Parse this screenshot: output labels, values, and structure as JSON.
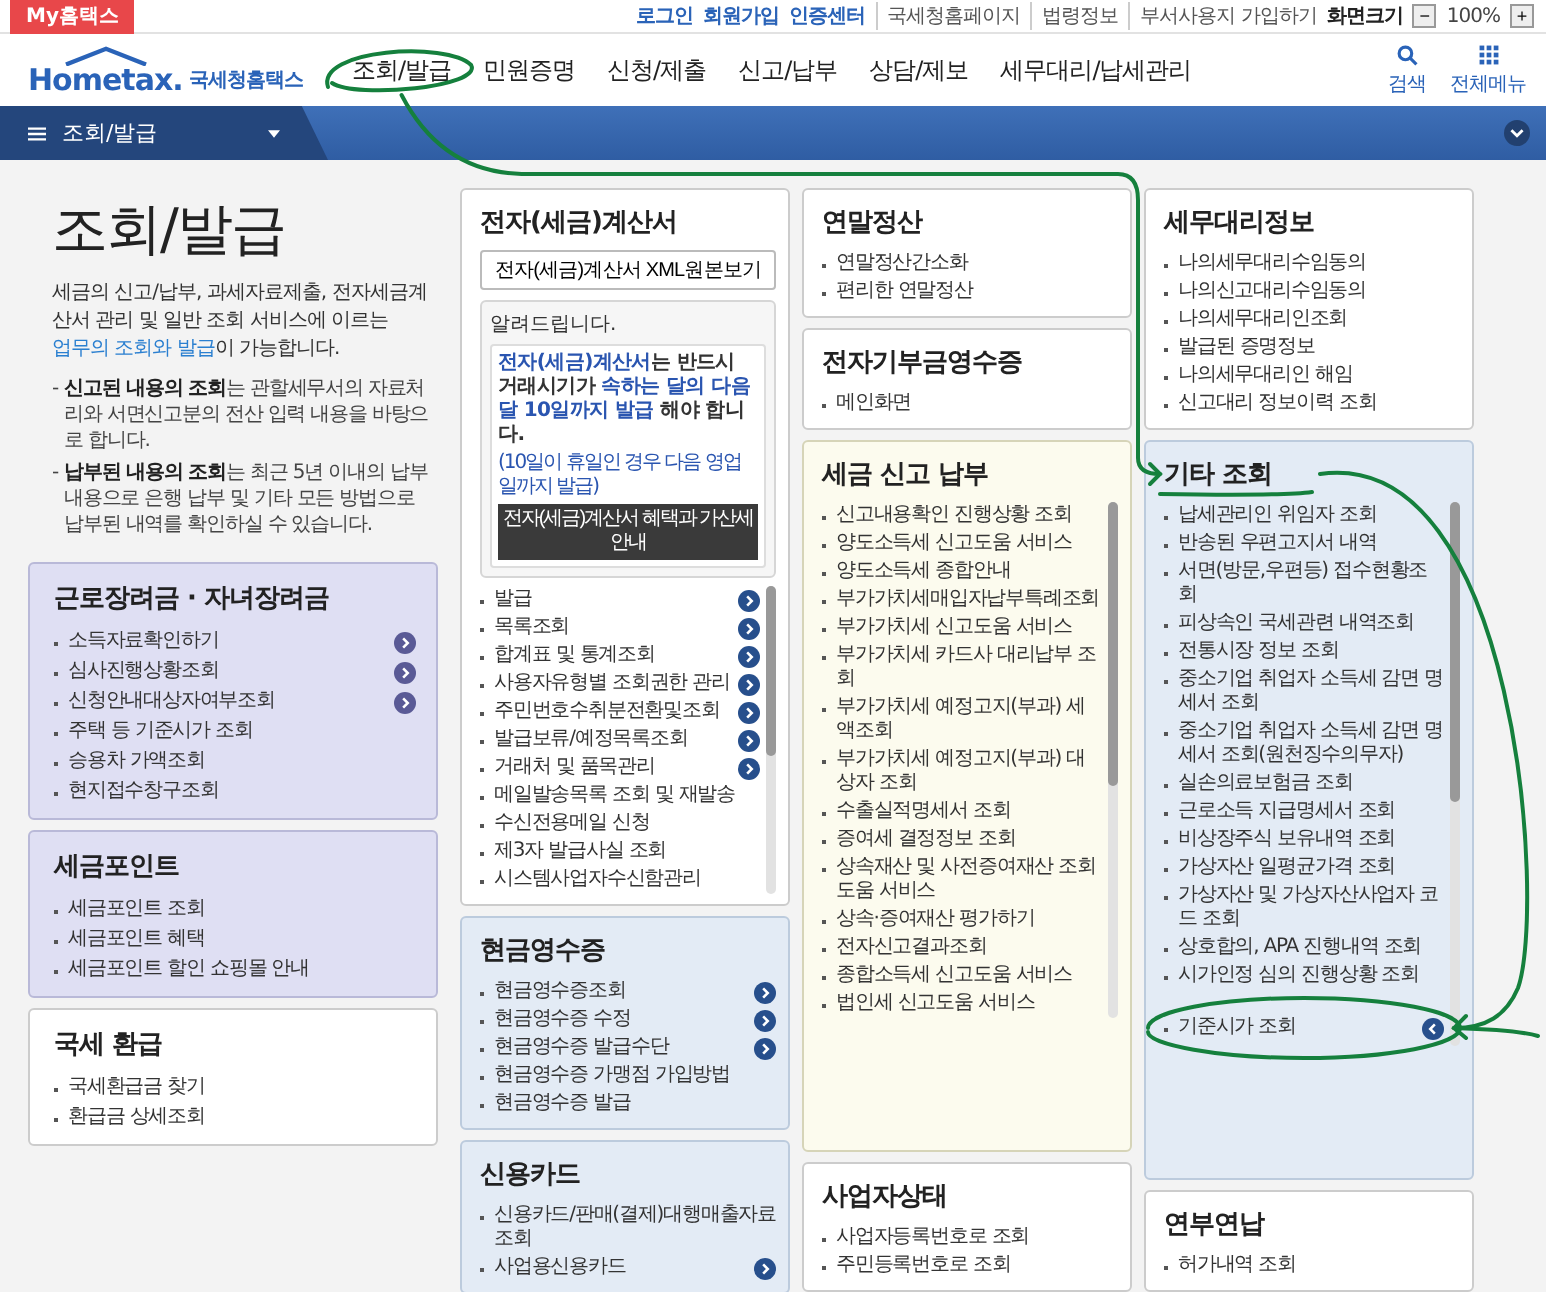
{
  "top_bar": {
    "my_tab": "My홈택스",
    "links": [
      {
        "label": "로그인",
        "kind": "primary"
      },
      {
        "label": "회원가입",
        "kind": "primary"
      },
      {
        "label": "인증센터",
        "kind": "primary"
      },
      {
        "label": "국세청홈페이지",
        "kind": "secondary"
      },
      {
        "label": "법령정보",
        "kind": "secondary"
      },
      {
        "label": "부서사용지 가입하기",
        "kind": "secondary"
      }
    ],
    "zoom": {
      "label": "화면크기",
      "decrease": "−",
      "value": "100%",
      "increase": "+"
    }
  },
  "header": {
    "logo": {
      "brand": "Hometax.",
      "name": "국세청홈택스"
    },
    "nav": [
      "조회/발급",
      "민원증명",
      "신청/제출",
      "신고/납부",
      "상담/제보",
      "세무대리/납세관리"
    ],
    "search": "검색",
    "all_menu": "전체메뉴"
  },
  "breadcrumb": {
    "label": "조회/발급"
  },
  "intro": {
    "title": "조회/발급",
    "description": {
      "before": "세금의 신고/납부, 과세자료제출, 전자세금계산서 관리 및 일반 조회 서비스에 이르는 ",
      "link": "업무의 조회와 발급",
      "after": "이 가능합니다."
    },
    "notes": [
      {
        "marker": "-",
        "text": "**신고된 내용의 조회**는 관할세무서의 자료처리와 서면신고분의 전산 입력 내용을 바탕으로 합니다."
      },
      {
        "marker": "-",
        "text": "**납부된 내용의 조회**는 최근 5년 이내의 납부 내용으로 은행 납부 및 기타 모든 방법으로 납부된 내역를 확인하실 수 있습니다."
      }
    ]
  },
  "columns": [
    {
      "cards": [
        {
          "title": "근로장려금 · 자녀장려금",
          "kind": "lavender",
          "scrollable": false,
          "items": [
            {
              "label": "소득자료확인하기",
              "kind": "more"
            },
            {
              "label": "심사진행상황조회",
              "kind": "more"
            },
            {
              "label": "신청안내대상자여부조회",
              "kind": "more"
            },
            {
              "label": "주택 등 기준시가 조회",
              "kind": "plain"
            },
            {
              "label": "승용차 가액조회",
              "kind": "plain"
            },
            {
              "label": "현지접수창구조회",
              "kind": "plain"
            }
          ]
        },
        {
          "title": "세금포인트",
          "kind": "lavender",
          "scrollable": false,
          "items": [
            {
              "label": "세금포인트 조회",
              "kind": "plain"
            },
            {
              "label": "세금포인트 혜택",
              "kind": "plain"
            },
            {
              "label": "세금포인트 할인 쇼핑몰 안내",
              "kind": "plain"
            }
          ]
        },
        {
          "title": "국세 환급",
          "kind": "plain",
          "scrollable": false,
          "items": [
            {
              "label": "국세환급금 찾기",
              "kind": "plain"
            },
            {
              "label": "환급금 상세조회",
              "kind": "plain"
            }
          ]
        }
      ]
    },
    {
      "cards": [
        {
          "title": "전자(세금)계산서",
          "kind": "plain",
          "scrollable": true,
          "xml_button": "전자(세금)계산서 XML원본보기",
          "notice": {
            "heading": "알려드립니다.",
            "message": "**전자(세금)계산서**는 반드시 거래시기가 **속하는 달의 다음달 10일까지 발급** 해야 합니다.",
            "footnote": "(10일이 휴일인 경우 다음 영업일까지 발급)",
            "button": "전자(세금)계산서 혜택과 가산세 안내"
          },
          "items": [
            {
              "label": "발급",
              "kind": "more"
            },
            {
              "label": "목록조회",
              "kind": "more"
            },
            {
              "label": "합계표 및 통계조회",
              "kind": "more"
            },
            {
              "label": "사용자유형별 조회권한 관리",
              "kind": "more"
            },
            {
              "label": "주민번호수취분전환및조회",
              "kind": "more"
            },
            {
              "label": "발급보류/예정목록조회",
              "kind": "more"
            },
            {
              "label": "거래처 및 품목관리",
              "kind": "more"
            },
            {
              "label": "메일발송목록 조회 및 재발송",
              "kind": "plain"
            },
            {
              "label": "수신전용메일 신청",
              "kind": "plain"
            },
            {
              "label": "제3자 발급사실 조회",
              "kind": "plain"
            },
            {
              "label": "시스템사업자수신함관리",
              "kind": "plain"
            }
          ]
        },
        {
          "title": "현금영수증",
          "kind": "blue",
          "scrollable": false,
          "items": [
            {
              "label": "현금영수증조회",
              "kind": "more"
            },
            {
              "label": "현금영수증 수정",
              "kind": "more"
            },
            {
              "label": "현금영수증 발급수단",
              "kind": "more"
            },
            {
              "label": "현금영수증 가맹점 가입방법",
              "kind": "plain"
            },
            {
              "label": "현금영수증 발급",
              "kind": "plain"
            }
          ]
        },
        {
          "title": "신용카드",
          "kind": "blue",
          "scrollable": false,
          "items": [
            {
              "label": "신용카드/판매(결제)대행매출자료조회",
              "kind": "plain"
            },
            {
              "label": "사업용신용카드",
              "kind": "more"
            }
          ]
        }
      ]
    },
    {
      "cards": [
        {
          "title": "연말정산",
          "kind": "plain",
          "scrollable": false,
          "items": [
            {
              "label": "연말정산간소화",
              "kind": "plain"
            },
            {
              "label": "편리한 연말정산",
              "kind": "plain"
            }
          ]
        },
        {
          "title": "전자기부금영수증",
          "kind": "plain",
          "scrollable": false,
          "items": [
            {
              "label": "메인화면",
              "kind": "plain"
            }
          ]
        },
        {
          "title": "세금 신고 납부",
          "kind": "cream",
          "scrollable": true,
          "items": [
            {
              "label": "신고내용확인 진행상황 조회",
              "kind": "plain"
            },
            {
              "label": "양도소득세 신고도움 서비스",
              "kind": "plain"
            },
            {
              "label": "양도소득세 종합안내",
              "kind": "plain"
            },
            {
              "label": "부가가치세매입자납부특례조회",
              "kind": "plain"
            },
            {
              "label": "부가가치세 신고도움 서비스",
              "kind": "plain"
            },
            {
              "label": "부가가치세 카드사 대리납부 조회",
              "kind": "plain"
            },
            {
              "label": "부가가치세 예정고지(부과) 세액조회",
              "kind": "plain"
            },
            {
              "label": "부가가치세 예정고지(부과) 대상자 조회",
              "kind": "plain"
            },
            {
              "label": "수출실적명세서 조회",
              "kind": "plain"
            },
            {
              "label": "증여세 결정정보 조회",
              "kind": "plain"
            },
            {
              "label": "상속재산 및 사전증여재산 조회도움 서비스",
              "kind": "plain"
            },
            {
              "label": "상속·증여재산 평가하기",
              "kind": "plain"
            },
            {
              "label": "전자신고결과조회",
              "kind": "plain"
            },
            {
              "label": "종합소득세 신고도움 서비스",
              "kind": "plain"
            },
            {
              "label": "법인세 신고도움 서비스",
              "kind": "plain"
            }
          ]
        },
        {
          "title": "사업자상태",
          "kind": "plain",
          "scrollable": false,
          "items": [
            {
              "label": "사업자등록번호로 조회",
              "kind": "plain"
            },
            {
              "label": "주민등록번호로 조회",
              "kind": "plain"
            }
          ]
        }
      ]
    },
    {
      "cards": [
        {
          "title": "세무대리정보",
          "kind": "plain",
          "scrollable": false,
          "items": [
            {
              "label": "나의세무대리수임동의",
              "kind": "plain"
            },
            {
              "label": "나의신고대리수임동의",
              "kind": "plain"
            },
            {
              "label": "나의세무대리인조회",
              "kind": "plain"
            },
            {
              "label": "발급된 증명정보",
              "kind": "plain"
            },
            {
              "label": "나의세무대리인 해임",
              "kind": "plain"
            },
            {
              "label": "신고대리 정보이력 조회",
              "kind": "plain"
            }
          ]
        },
        {
          "title": "기타 조회",
          "kind": "blue",
          "scrollable": true,
          "items": [
            {
              "label": "납세관리인 위임자 조회",
              "kind": "plain"
            },
            {
              "label": "반송된 우편고지서 내역",
              "kind": "plain"
            },
            {
              "label": "서면(방문,우편등) 접수현황조회",
              "kind": "plain"
            },
            {
              "label": "피상속인 국세관련 내역조회",
              "kind": "plain"
            },
            {
              "label": "전통시장 정보 조회",
              "kind": "plain"
            },
            {
              "label": "중소기업 취업자 소득세 감면 명세서 조회",
              "kind": "plain"
            },
            {
              "label": "중소기업 취업자 소득세 감면 명세서 조회(원천징수의무자)",
              "kind": "plain"
            },
            {
              "label": "실손의료보험금 조회",
              "kind": "plain"
            },
            {
              "label": "근로소득 지급명세서 조회",
              "kind": "plain"
            },
            {
              "label": "비상장주식 보유내역 조회",
              "kind": "plain"
            },
            {
              "label": "가상자산 일평균가격 조회",
              "kind": "plain"
            },
            {
              "label": "가상자산 및 가상자산사업자 코드 조회",
              "kind": "plain"
            },
            {
              "label": "상호합의, APA 진행내역 조회",
              "kind": "plain"
            },
            {
              "label": "시가인정 심의 진행상황 조회",
              "kind": "plain"
            },
            {
              "label": "기준시가 조회",
              "kind": "open"
            }
          ]
        },
        {
          "title": "연부연납",
          "kind": "plain",
          "scrollable": false,
          "items": [
            {
              "label": "허가내역 조회",
              "kind": "plain"
            }
          ]
        }
      ]
    }
  ]
}
